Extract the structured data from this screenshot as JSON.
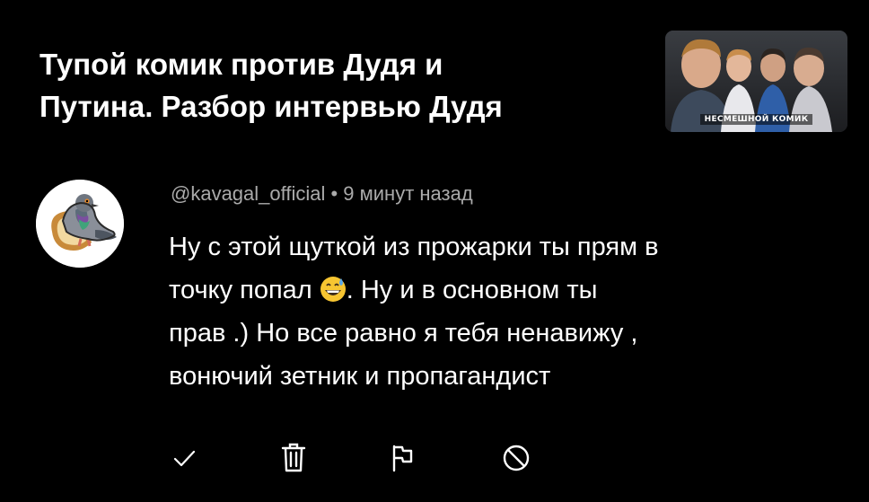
{
  "video": {
    "title_line1": "Тупой комик против Дудя и",
    "title_line2": "Путина. Разбор интервью Дудя",
    "thumbnail_caption": "НЕСМЕШНОЙ КОМИК"
  },
  "comment": {
    "author": "@kavagal_official",
    "separator": " • ",
    "time": "9 минут назад",
    "line1": "Ну с этой щуткой из прожарки ты прям в",
    "line2a": "точку попал",
    "emoji": "grinning-face-with-sweat",
    "line2b": ".  Ну и в основном ты",
    "line3": "прав .) Но все равно я тебя ненавижу ,",
    "line4": "вонючий зетник и пропагандист"
  },
  "actions": {
    "icons": [
      "check-icon",
      "trash-icon",
      "flag-icon",
      "block-icon"
    ]
  },
  "colors": {
    "background": "#000000",
    "text": "#ffffff",
    "meta": "#aaaaaa",
    "emoji_face": "#f7c531"
  }
}
